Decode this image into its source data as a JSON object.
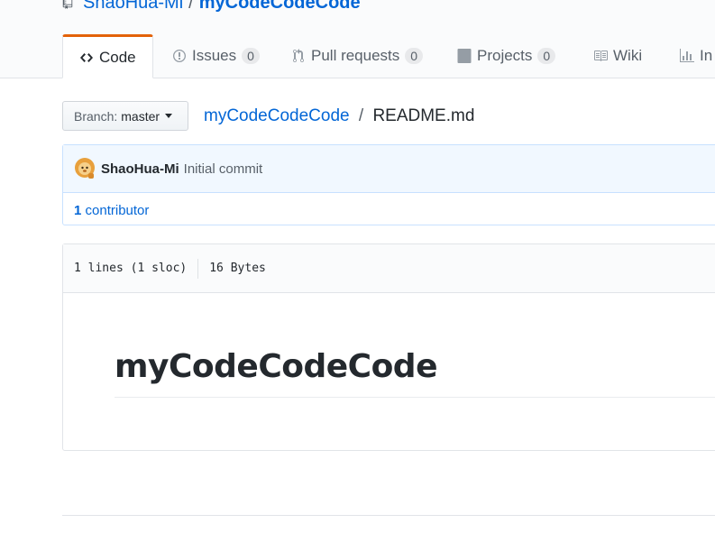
{
  "repo": {
    "owner": "ShaoHua-Mi",
    "separator": "/",
    "name": "myCodeCodeCode"
  },
  "tabs": [
    {
      "label": "Code",
      "icon": "code-icon",
      "selected": true
    },
    {
      "label": "Issues",
      "count": "0",
      "icon": "issue-opened-icon"
    },
    {
      "label": "Pull requests",
      "count": "0",
      "icon": "git-pull-request-icon"
    },
    {
      "label": "Projects",
      "count": "0",
      "icon": "project-icon"
    },
    {
      "label": "Wiki",
      "icon": "book-icon"
    },
    {
      "label": "In",
      "icon": "graph-icon"
    }
  ],
  "branch": {
    "label": "Branch:",
    "value": "master"
  },
  "breadcrumb": {
    "repo": "myCodeCodeCode",
    "separator": "/",
    "file": "README.md"
  },
  "commit": {
    "author": "ShaoHua-Mi",
    "message": "Initial commit"
  },
  "contributors": {
    "count": "1",
    "label": "contributor"
  },
  "file": {
    "lines": "1 lines (1 sloc)",
    "size": "16 Bytes"
  },
  "readme": {
    "heading": "myCodeCodeCode"
  },
  "colors": {
    "link": "#0366d6",
    "tab_accent": "#e36209",
    "commit_bg": "#f1f8ff"
  }
}
